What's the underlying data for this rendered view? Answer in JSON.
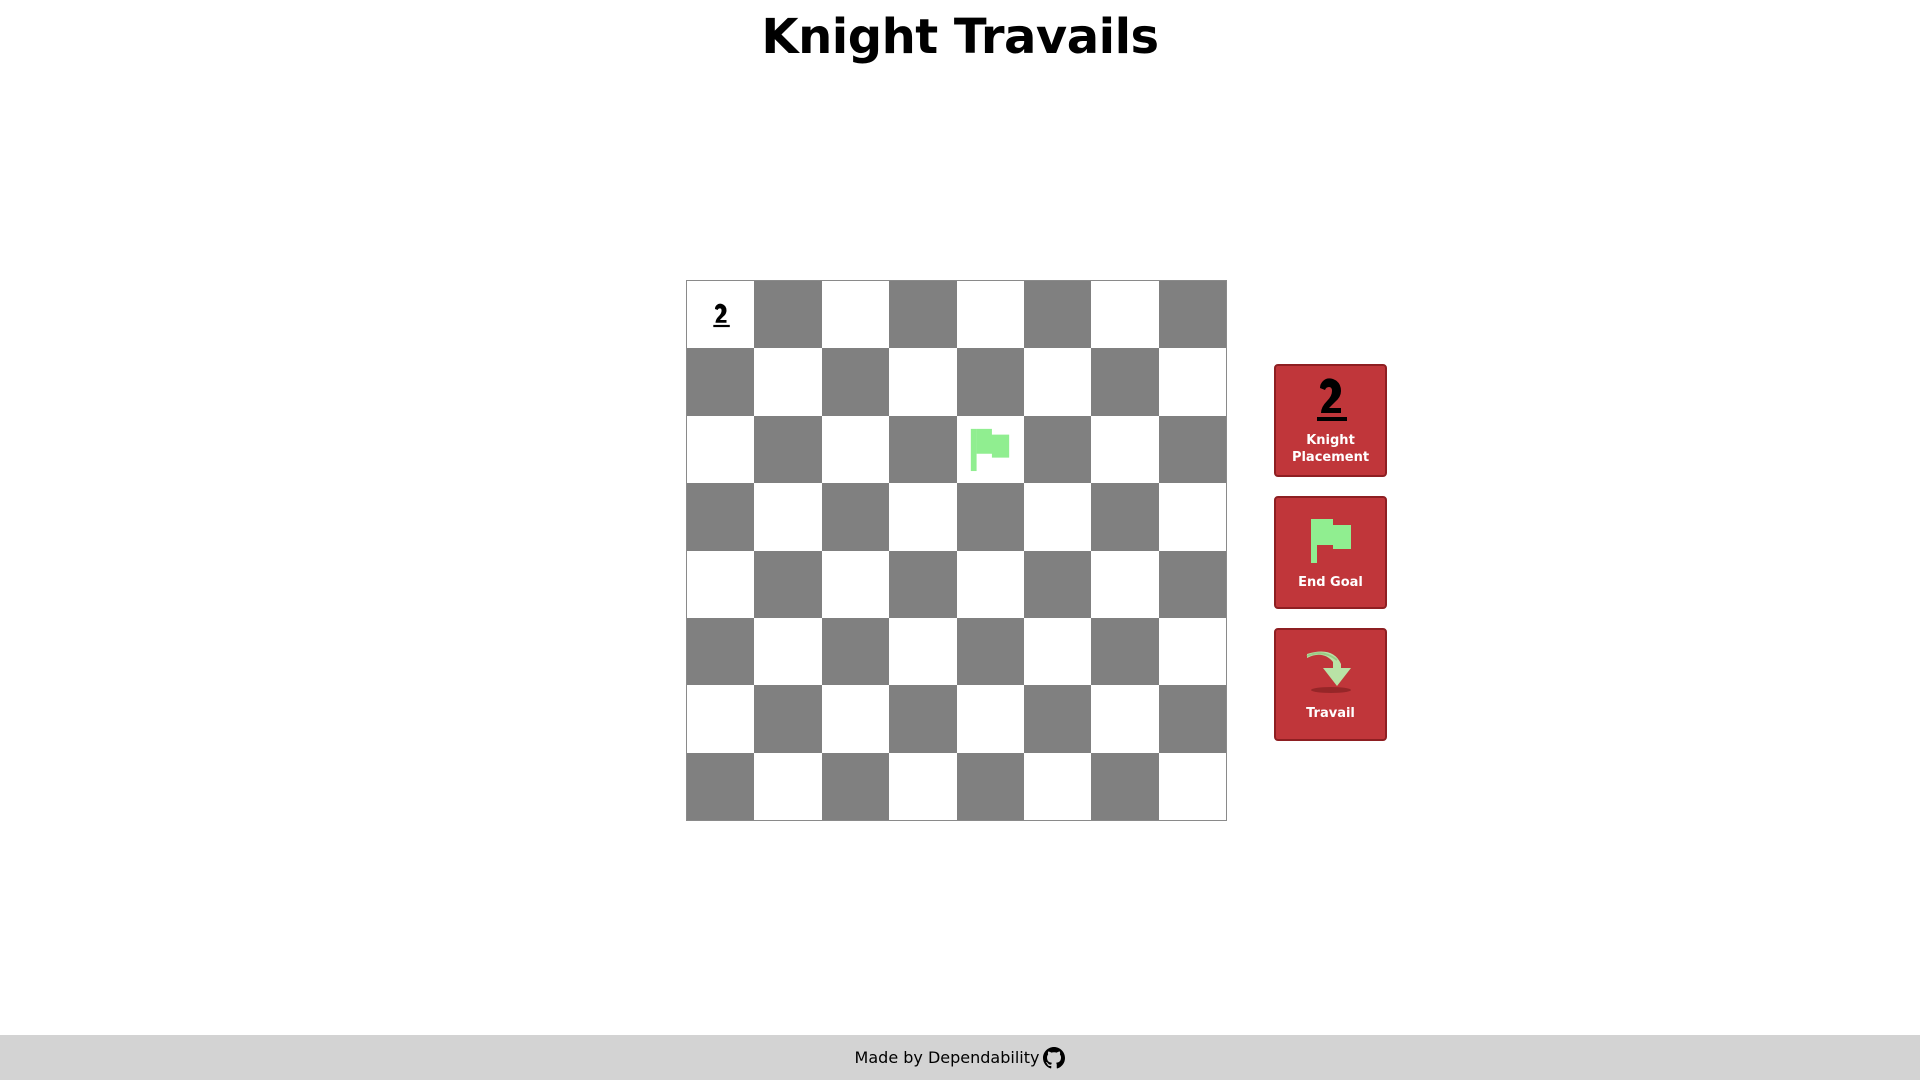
{
  "page": {
    "title": "Knight Travails"
  },
  "board": {
    "size": 8,
    "knight_square": "a8",
    "goal_square": "e6",
    "colors": {
      "light": "#ffffff",
      "dark": "#808080",
      "goal_flag": "#90ee90",
      "knight": "#000000"
    }
  },
  "controls": {
    "knight_placement": {
      "label": "Knight\nPlacement",
      "icon": "knight-icon"
    },
    "end_goal": {
      "label": "End Goal",
      "icon": "flag-icon"
    },
    "travail": {
      "label": "Travail",
      "icon": "curved-arrow-icon"
    },
    "button_color": "#c0363a"
  },
  "footer": {
    "text": "Made by Dependability",
    "icon": "github-icon"
  }
}
